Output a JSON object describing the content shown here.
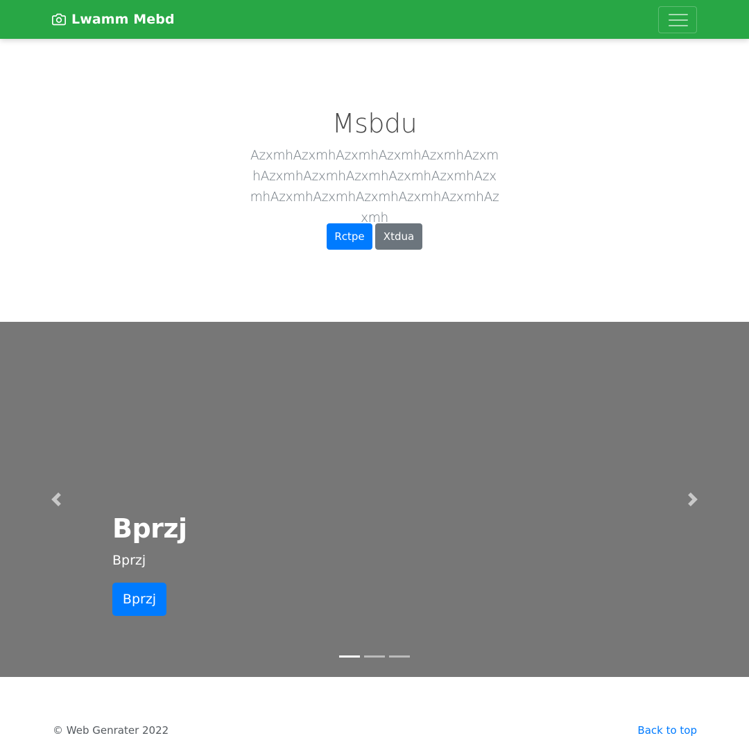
{
  "navbar": {
    "brand_icon": "camera-icon",
    "brand": "Lwamm Mebd",
    "toggler_icon": "hamburger-menu-icon",
    "background": "#28a745"
  },
  "hero": {
    "title": "Msbdu",
    "lead": "AzxmhAzxmhAzxmhAzxmhAzxmhAzxmhAzxmhAzxmhAzxmhAzxmhAzxmhAzxmhAzxmhAzxmhAzxmhAzxmhAzxmhAzxmh",
    "primary_button": "Rctpe",
    "secondary_button": "Xtdua"
  },
  "carousel": {
    "background": "#777777",
    "prev_icon": "chevron-left-icon",
    "next_icon": "chevron-right-icon",
    "slide": {
      "title": "Bprzj",
      "text": "Bprzj",
      "button": "Bprzj"
    },
    "indicators": 3,
    "active_indicator": 1
  },
  "footer": {
    "copyright": "© Web Genrater 2022",
    "back_to_top": "Back to top"
  },
  "colors": {
    "primary": "#007bff",
    "secondary": "#6c757d",
    "success": "#28a745"
  }
}
